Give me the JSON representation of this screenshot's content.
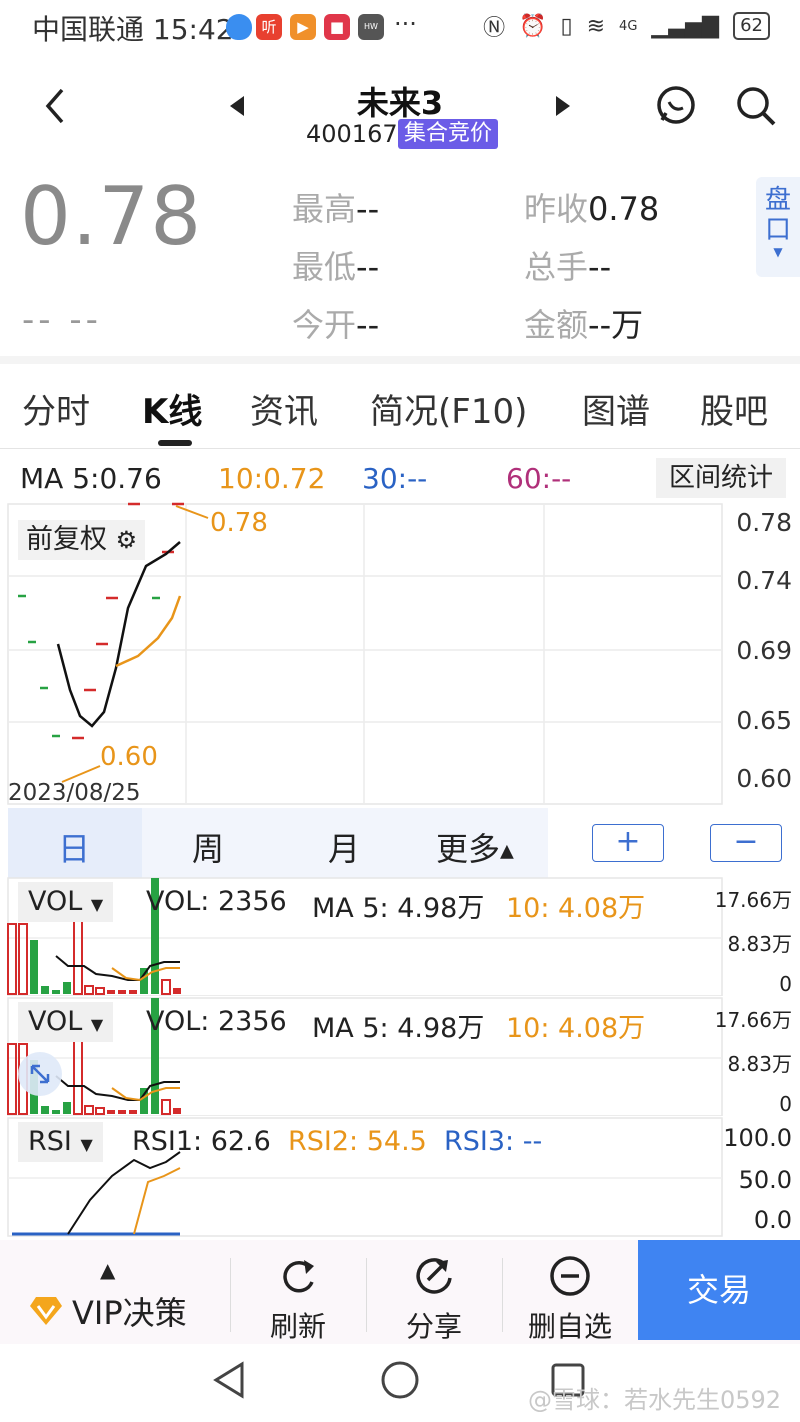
{
  "status_bar": {
    "carrier_time": "中国联通 15:42",
    "app_icons": [
      "听"
    ],
    "network": "4G",
    "battery": "62"
  },
  "header": {
    "title": "未来3",
    "code": "400167",
    "badge": "集合竞价"
  },
  "quote": {
    "price": "0.78",
    "change": "--  --",
    "high_label": "最高",
    "high_value": "--",
    "low_label": "最低",
    "low_value": "--",
    "open_label": "今开",
    "open_value": "--",
    "prev_close_label": "昨收",
    "prev_close_value": "0.78",
    "volume_label": "总手",
    "volume_value": "--",
    "amount_label": "金额",
    "amount_value": "--万",
    "pankou": "盘口"
  },
  "tabs": [
    {
      "label": "分时"
    },
    {
      "label": "K线"
    },
    {
      "label": "资讯"
    },
    {
      "label": "简况(F10)"
    },
    {
      "label": "图谱"
    },
    {
      "label": "股吧"
    }
  ],
  "ma_row": {
    "ma5": "MA 5:0.76",
    "ma10": "10:0.72",
    "ma30": "30:--",
    "ma60": "60:--",
    "range_stats": "区间统计"
  },
  "kline": {
    "adjust": "前复权",
    "high_marker": "0.78",
    "low_marker": "0.60",
    "date": "2023/08/25",
    "y_ticks": [
      "0.78",
      "0.74",
      "0.69",
      "0.65",
      "0.60"
    ]
  },
  "periods": [
    "日",
    "周",
    "月",
    "更多"
  ],
  "zoom": {
    "plus": "+",
    "minus": "−"
  },
  "vol_panels": [
    {
      "tag": "VOL",
      "vol": "VOL: 2356",
      "ma5": "MA 5: 4.98万",
      "ma10": "10: 4.08万",
      "y_ticks": [
        "17.66万",
        "8.83万",
        "0"
      ]
    },
    {
      "tag": "VOL",
      "vol": "VOL: 2356",
      "ma5": "MA 5: 4.98万",
      "ma10": "10: 4.08万",
      "y_ticks": [
        "17.66万",
        "8.83万",
        "0"
      ]
    }
  ],
  "rsi": {
    "tag": "RSI",
    "rsi1": "RSI1: 62.6",
    "rsi2": "RSI2: 54.5",
    "rsi3": "RSI3: --",
    "y_ticks": [
      "100.0",
      "50.0",
      "0.0"
    ]
  },
  "bottom_bar": {
    "vip": "VIP决策",
    "refresh": "刷新",
    "share": "分享",
    "delete_watch": "删自选",
    "trade": "交易"
  },
  "watermark": "@雪球：若水先生0592",
  "colors": {
    "accent_blue": "#3d6fd0",
    "ma10_orange": "#e8951a",
    "ma30_blue": "#2a62c4",
    "ma60_purple": "#b0307a",
    "up_red": "#d42b2b",
    "down_green": "#27a243",
    "trade_blue": "#3f84f2"
  }
}
